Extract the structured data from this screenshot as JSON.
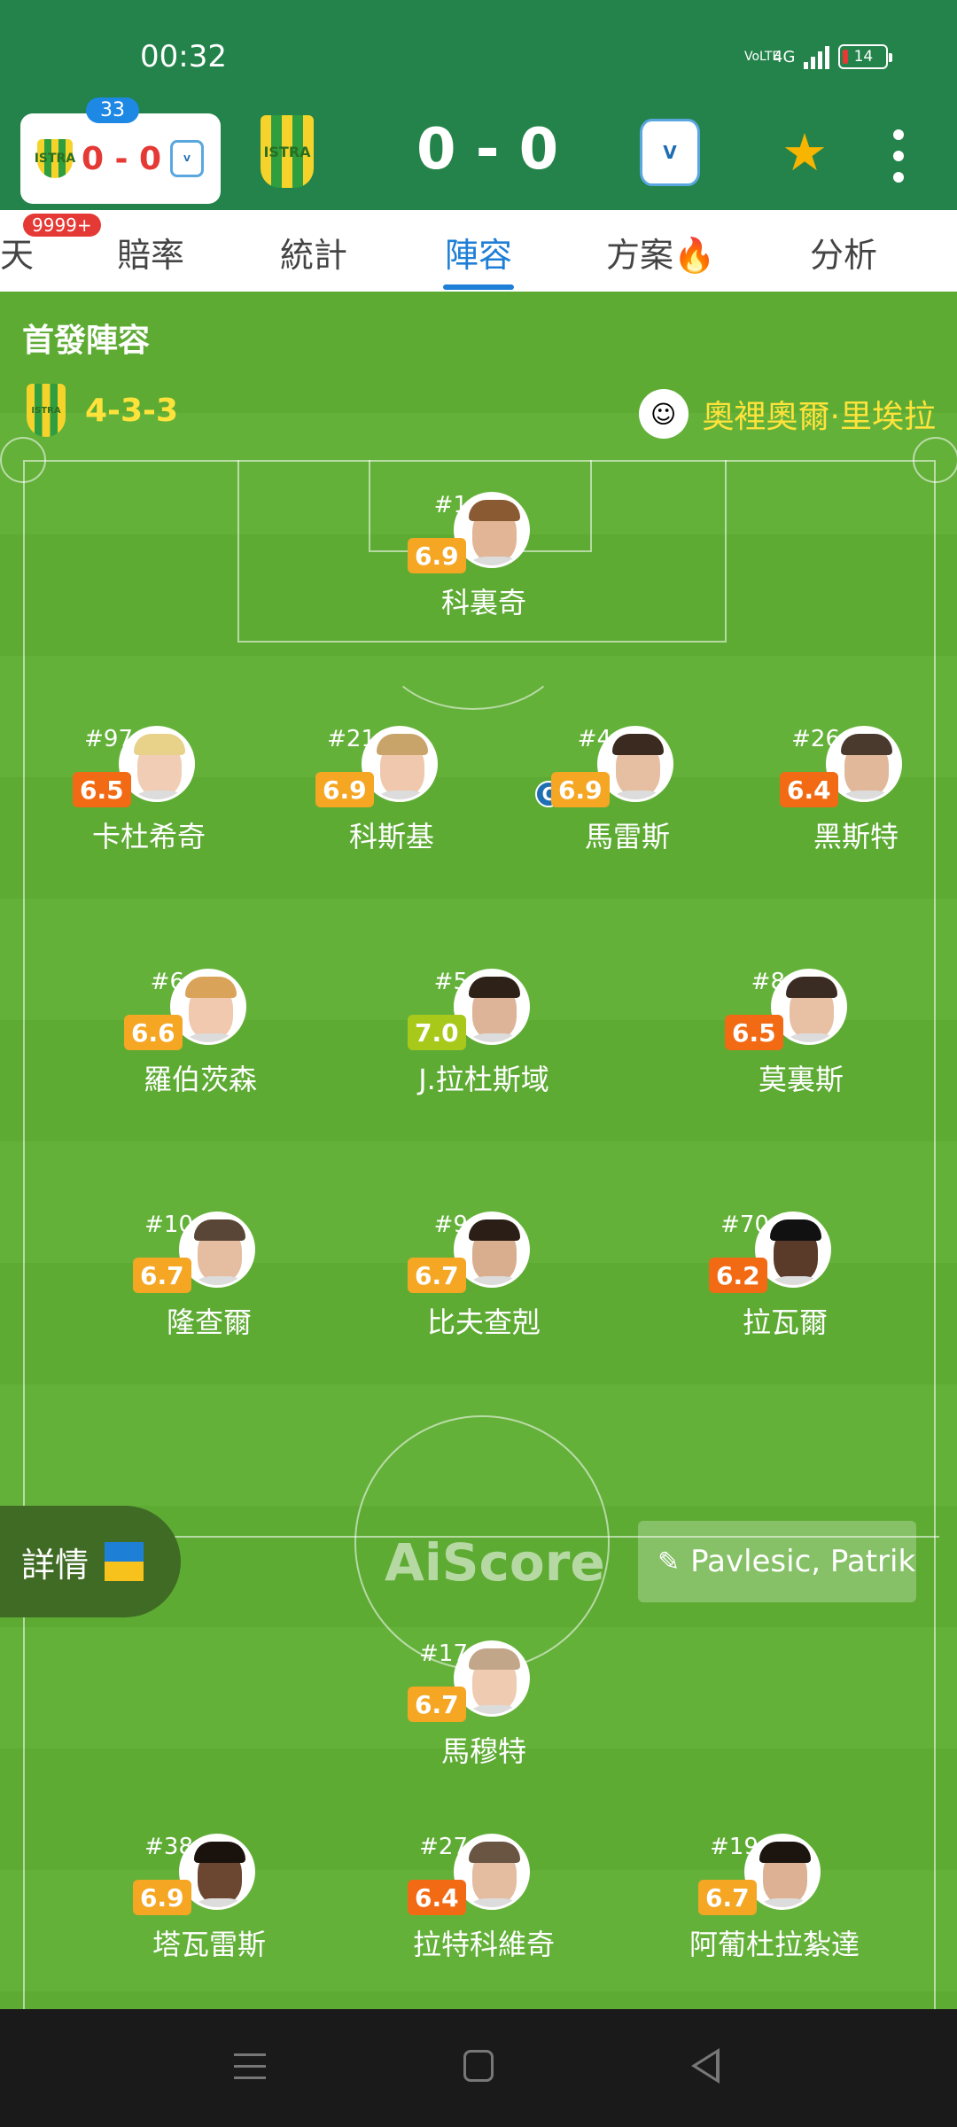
{
  "status_bar": {
    "time": "00:32",
    "network_label": "VoLTE",
    "network_type": "4G",
    "battery": "14"
  },
  "match_header": {
    "mini_score": "0 - 0",
    "mini_badge": "33",
    "big_score": "0 - 0",
    "home_crest_icon": "team-crest-yellow-green",
    "away_crest_icon": "team-crest-blue-white",
    "star_icon": "star-icon",
    "star_color": "#f7b500",
    "more_icon": "more-vertical-icon"
  },
  "tabs": {
    "items": [
      {
        "label": "天"
      },
      {
        "label": "賠率"
      },
      {
        "label": "統計"
      },
      {
        "label": "陣容"
      },
      {
        "label": "方案🔥"
      },
      {
        "label": "分析"
      }
    ],
    "active": "陣容",
    "badge": "9999+"
  },
  "lineup": {
    "section_title": "首發陣容",
    "formation": "4-3-3",
    "coach_name": "奧裡奧爾·里埃拉",
    "players": [
      {
        "num": "#1",
        "rating": "6.9",
        "name": "科裏奇"
      },
      {
        "num": "#97",
        "rating": "6.5",
        "name": "卡杜希奇"
      },
      {
        "num": "#21",
        "rating": "6.9",
        "name": "科斯基"
      },
      {
        "num": "#4",
        "rating": "6.9",
        "name": "馬雷斯",
        "captain": "C"
      },
      {
        "num": "#26",
        "rating": "6.4",
        "name": "黑斯特"
      },
      {
        "num": "#6",
        "rating": "6.6",
        "name": "羅伯茨森"
      },
      {
        "num": "#5",
        "rating": "7.0",
        "name": "J.拉杜斯域"
      },
      {
        "num": "#8",
        "rating": "6.5",
        "name": "莫裏斯"
      },
      {
        "num": "#10",
        "rating": "6.7",
        "name": "隆查爾"
      },
      {
        "num": "#9",
        "rating": "6.7",
        "name": "比夫查剋"
      },
      {
        "num": "#70",
        "rating": "6.2",
        "name": "拉瓦爾"
      },
      {
        "num": "#17",
        "rating": "6.7",
        "name": "馬穆特"
      },
      {
        "num": "#38",
        "rating": "6.9",
        "name": "塔瓦雷斯"
      },
      {
        "num": "#27",
        "rating": "6.4",
        "name": "拉特科維奇"
      },
      {
        "num": "#19",
        "rating": "6.7",
        "name": "阿葡杜拉紮達"
      }
    ],
    "rating_colors": {
      "green": "#a8c91a",
      "yellow": "#f5a623",
      "orange": "#f26a13"
    }
  },
  "overlay": {
    "details_label": "詳情",
    "watermark": "AiScore",
    "referee_name": "Pavlesic, Patrik",
    "referee_icon": "whistle-icon"
  }
}
